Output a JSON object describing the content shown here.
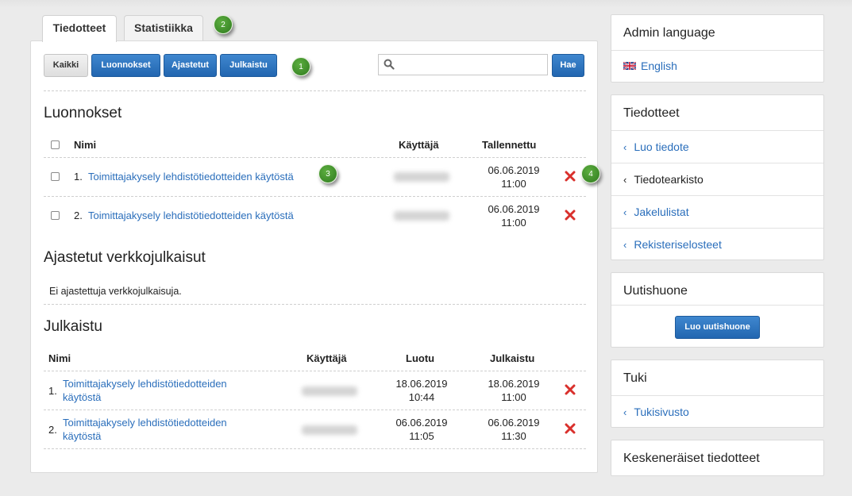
{
  "tabs": [
    {
      "label": "Tiedotteet",
      "active": true
    },
    {
      "label": "Statistiikka",
      "active": false
    }
  ],
  "filters": {
    "all": "Kaikki",
    "drafts": "Luonnokset",
    "scheduled": "Ajastetut",
    "published": "Julkaistu"
  },
  "search": {
    "value": "",
    "placeholder": "",
    "button": "Hae"
  },
  "drafts": {
    "title": "Luonnokset",
    "columns": {
      "name": "Nimi",
      "user": "Käyttäjä",
      "saved": "Tallennettu"
    },
    "rows": [
      {
        "num": "1.",
        "name": "Toimittajakysely lehdistötiedotteiden käytöstä",
        "date": "06.06.2019",
        "time": "11:00"
      },
      {
        "num": "2.",
        "name": "Toimittajakysely lehdistötiedotteiden käytöstä",
        "date": "06.06.2019",
        "time": "11:00"
      }
    ]
  },
  "scheduled": {
    "title": "Ajastetut verkkojulkaisut",
    "empty": "Ei ajastettuja verkkojulkaisuja."
  },
  "published": {
    "title": "Julkaistu",
    "columns": {
      "name": "Nimi",
      "user": "Käyttäjä",
      "created": "Luotu",
      "published": "Julkaistu"
    },
    "rows": [
      {
        "num": "1.",
        "name_line1": "Toimittajakysely lehdistötiedotteiden",
        "name_line2": "käytöstä",
        "created_date": "18.06.2019",
        "created_time": "10:44",
        "pub_date": "18.06.2019",
        "pub_time": "11:00"
      },
      {
        "num": "2.",
        "name_line1": "Toimittajakysely lehdistötiedotteiden",
        "name_line2": "käytöstä",
        "created_date": "06.06.2019",
        "created_time": "11:05",
        "pub_date": "06.06.2019",
        "pub_time": "11:30"
      }
    ]
  },
  "badges": [
    "1",
    "2",
    "3",
    "4"
  ],
  "sidebar": {
    "admin_language": {
      "title": "Admin language",
      "language": "English"
    },
    "releases": {
      "title": "Tiedotteet",
      "links": [
        "Luo tiedote",
        "Tiedotearkisto",
        "Jakelulistat",
        "Rekisteriselosteet"
      ]
    },
    "newsroom": {
      "title": "Uutishuone",
      "button": "Luo uutishuone"
    },
    "support": {
      "title": "Tuki",
      "link": "Tukisivusto"
    },
    "unfinished": {
      "title": "Keskeneräiset tiedotteet"
    }
  },
  "colors": {
    "link": "#2a6ebb",
    "button_blue": "#2a6db3",
    "delete_red": "#d9302c",
    "badge_green": "#3d8c2a"
  }
}
